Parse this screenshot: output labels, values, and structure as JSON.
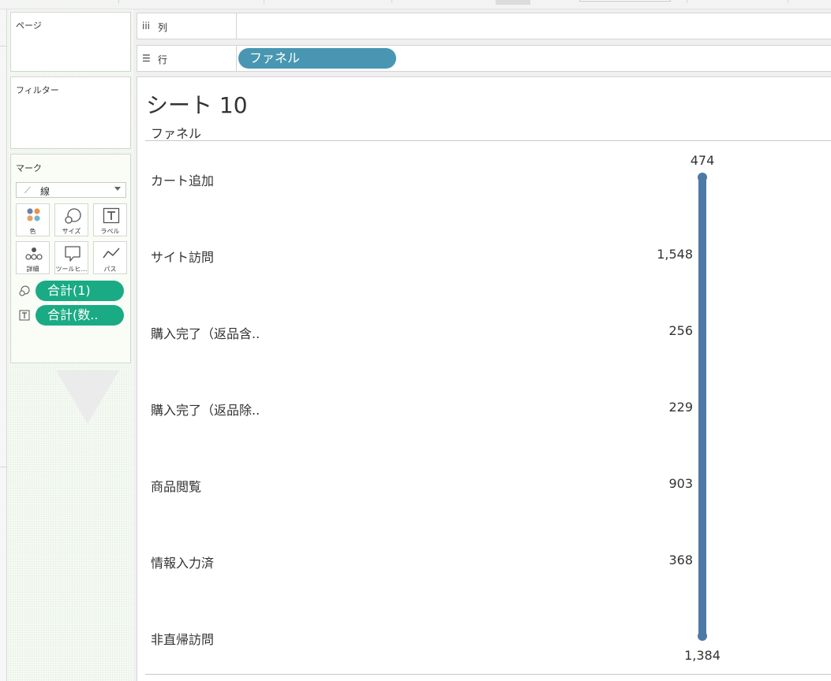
{
  "shelves": {
    "pages_label": "ページ",
    "filters_label": "フィルター",
    "marks_label": "マーク",
    "mark_type": "線",
    "mark_buttons": [
      "色",
      "サイズ",
      "ラベル",
      "詳細",
      "ツールヒ…",
      "パス"
    ],
    "mark_pills": [
      {
        "icon": "size-icon",
        "label": "合計(1)"
      },
      {
        "icon": "label-icon",
        "label": "合計(数.."
      }
    ],
    "columns_label": "列",
    "rows_label": "行",
    "rows_pill": "ファネル"
  },
  "view": {
    "title": "シート 10",
    "header": "ファネル"
  },
  "colors": {
    "line": "#4e79a7",
    "field_pill": "#4996b2",
    "measure_pill": "#1aab84"
  },
  "chart_data": {
    "type": "line",
    "categories": [
      "カート追加",
      "サイト訪問",
      "購入完了（返品含..",
      "購入完了（返品除..",
      "商品閲覧",
      "情報入力済",
      "非直帰訪問"
    ],
    "values": [
      474,
      1548,
      256,
      229,
      903,
      368,
      1384
    ],
    "value_labels": [
      "474",
      "1,548",
      "256",
      "229",
      "903",
      "368",
      "1,384"
    ],
    "title": "シート 10",
    "ylabel": "ファネル",
    "orientation": "vertical-categories",
    "grid": false
  }
}
